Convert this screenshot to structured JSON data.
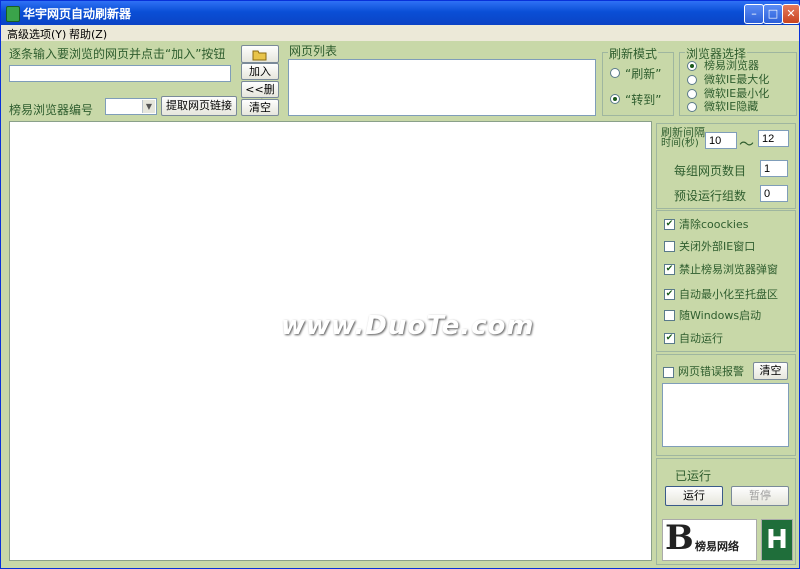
{
  "window": {
    "title": "华宇网页自动刷新器"
  },
  "menu": [
    {
      "label": "高级选项(Y)"
    },
    {
      "label": "帮助(Z)"
    }
  ],
  "input_section": {
    "instruction": "逐条输入要浏览的网页并点击“加入”按钮",
    "url_value": "",
    "browser_id_label": "榜易浏览器编号",
    "fetch_button": "提取网页链接"
  },
  "list_buttons": {
    "add": "加入>>",
    "remove": "<<删除",
    "clear": "清空"
  },
  "page_list": {
    "label": "网页列表"
  },
  "refresh_mode": {
    "label": "刷新模式",
    "options": [
      {
        "label": "“刷新”",
        "selected": false
      },
      {
        "label": "“转到”",
        "selected": true
      }
    ]
  },
  "browser_choice": {
    "label": "浏览器选择",
    "options": [
      {
        "label": "榜易浏览器",
        "selected": true
      },
      {
        "label": "微软IE最大化",
        "selected": false
      },
      {
        "label": "微软IE最小化",
        "selected": false
      },
      {
        "label": "微软IE隐藏",
        "selected": false
      }
    ]
  },
  "interval": {
    "label_line1": "刷新间隔",
    "label_line2": "时间(秒)",
    "min": "10",
    "separator": "～",
    "max": "12",
    "group_count_label": "每组网页数目",
    "group_count": "1",
    "preset_runs_label": "预设运行组数",
    "preset_runs": "0"
  },
  "options": [
    {
      "label": "清除coockies",
      "checked": true
    },
    {
      "label": "关闭外部IE窗口",
      "checked": false
    },
    {
      "label": "禁止榜易浏览器弹窗",
      "checked": true
    },
    {
      "label": "自动最小化至托盘区",
      "checked": true
    },
    {
      "label": "随Windows启动",
      "checked": false
    },
    {
      "label": "自动运行",
      "checked": true
    }
  ],
  "error_alarm": {
    "label": "网页错误报警",
    "checked": false,
    "clear_button": "清空"
  },
  "run": {
    "status": "已运行",
    "run_button": "运行",
    "pause_button": "暂停"
  },
  "watermark": {
    "text": "www.DuoTe.com"
  },
  "logo": {
    "text": "榜易网络",
    "letter": "B"
  },
  "colors": {
    "title_bar": "#0a4fd6",
    "panel_bg": "#c8d8a8",
    "label_green": "#2e5d2e"
  }
}
